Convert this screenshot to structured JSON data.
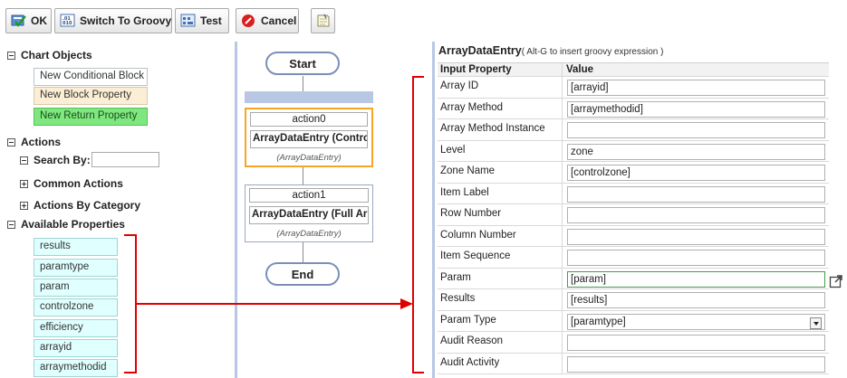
{
  "toolbar": {
    "ok_label": "OK",
    "switch_label": "Switch To Groovy",
    "test_label": "Test",
    "cancel_label": "Cancel"
  },
  "left": {
    "chart_objects": {
      "title": "Chart Objects",
      "items": [
        "New Conditional Block",
        "New Block Property",
        "New Return Property"
      ]
    },
    "actions": {
      "title": "Actions",
      "search_label": "Search By:",
      "search_value": "",
      "common": "Common Actions",
      "by_category": "Actions By Category"
    },
    "available": {
      "title": "Available Properties",
      "items": [
        "results",
        "paramtype",
        "param",
        "controlzone",
        "efficiency",
        "arrayid",
        "arraymethodid"
      ]
    }
  },
  "flow": {
    "start": "Start",
    "end": "End",
    "actions": [
      {
        "name": "action0",
        "title": "ArrayDataEntry (Control:",
        "type": "(ArrayDataEntry)"
      },
      {
        "name": "action1",
        "title": "ArrayDataEntry (Full Arra",
        "type": "(ArrayDataEntry)"
      }
    ]
  },
  "editor": {
    "title": "ArrayDataEntry",
    "hint": "( Alt-G to insert groovy expression )",
    "col_property": "Input Property",
    "col_value": "Value",
    "rows": [
      {
        "label": "Array ID",
        "value": "[arrayid]"
      },
      {
        "label": "Array Method",
        "value": "[arraymethodid]"
      },
      {
        "label": "Array Method Instance",
        "value": ""
      },
      {
        "label": "Level",
        "value": "zone"
      },
      {
        "label": "Zone Name",
        "value": "[controlzone]"
      },
      {
        "label": "Item Label",
        "value": ""
      },
      {
        "label": "Row Number",
        "value": ""
      },
      {
        "label": "Column Number",
        "value": ""
      },
      {
        "label": "Item Sequence",
        "value": ""
      },
      {
        "label": "Param",
        "value": "[param]"
      },
      {
        "label": "Results",
        "value": "[results]"
      },
      {
        "label": "Param Type",
        "value": "[paramtype]"
      },
      {
        "label": "Audit Reason",
        "value": ""
      },
      {
        "label": "Audit Activity",
        "value": ""
      }
    ]
  },
  "colors": {
    "annotation": "#e00000",
    "panel_divider": "#b8c8e4",
    "selected_action_border": "#f5a623"
  }
}
